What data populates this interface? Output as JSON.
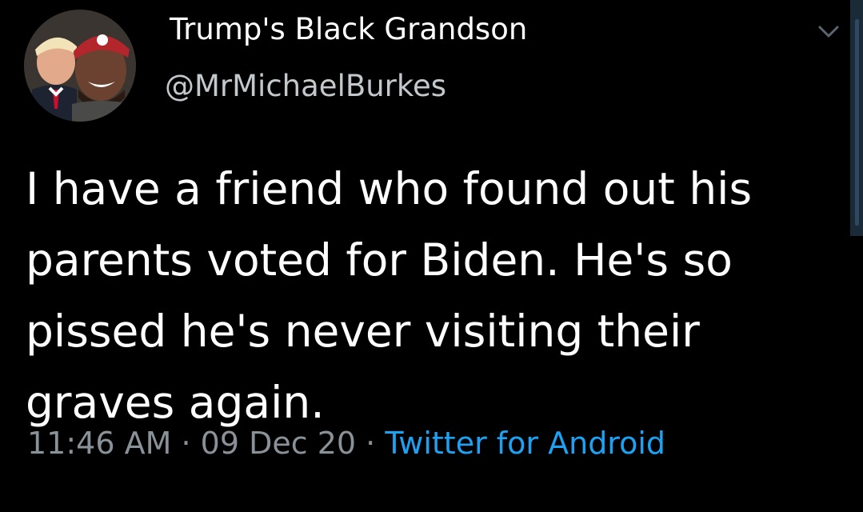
{
  "tweet": {
    "author": {
      "display_name": "Trump's Black Grandson",
      "handle": "@MrMichaelBurkes",
      "avatar_icon": "profile-photo"
    },
    "menu_icon": "chevron-down-icon",
    "body_lines": [
      "I have a friend who found out his",
      "parents voted for Biden. He's so",
      "pissed he's never visiting their",
      "graves again."
    ],
    "meta": {
      "time": "11:46 AM",
      "separator": "·",
      "date": "09 Dec 20",
      "source": "Twitter for Android"
    }
  },
  "colors": {
    "background": "#000000",
    "text": "#ffffff",
    "secondary_text": "#8a9299",
    "link": "#1da1f2"
  }
}
